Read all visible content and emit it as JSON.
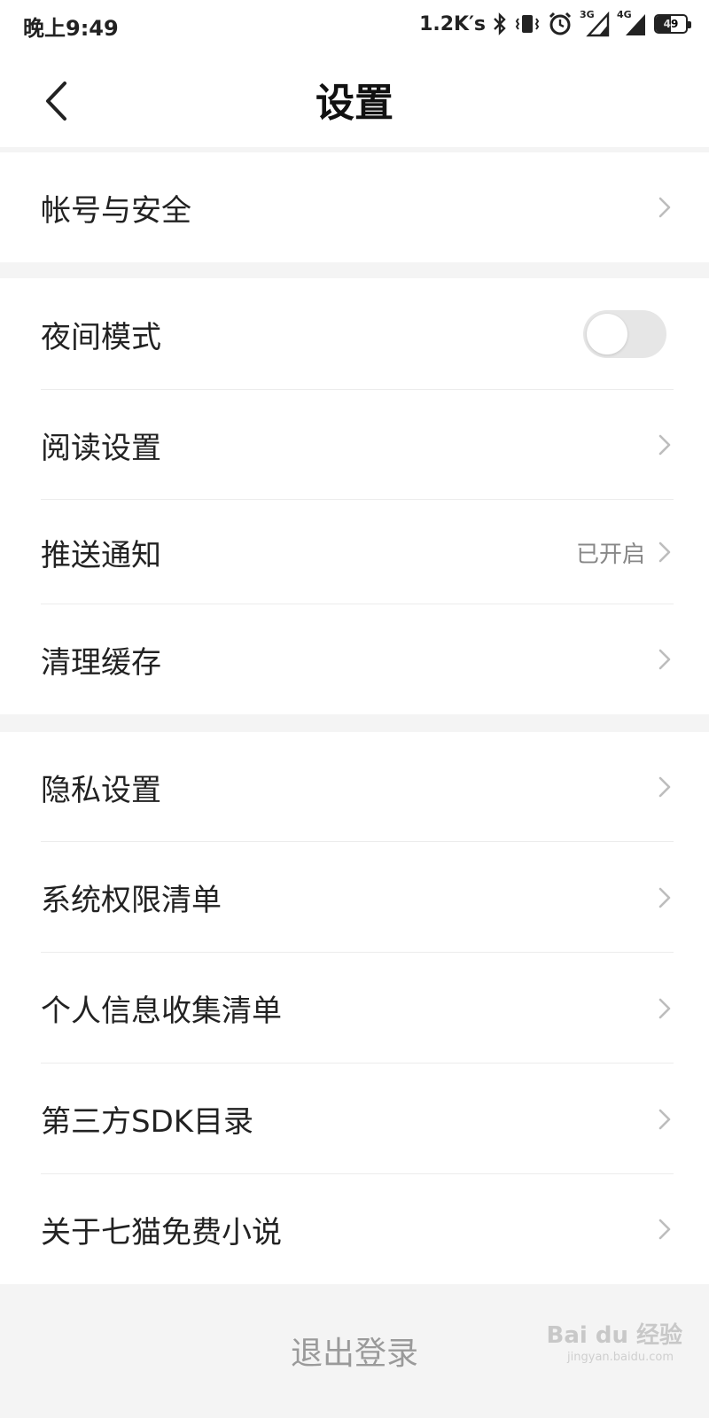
{
  "status_bar": {
    "time": "晚上9:49",
    "net_speed": "1.2K′s",
    "sig1_label": "3G",
    "sig2_label": "4G",
    "battery": "49",
    "battery_level": 0.49
  },
  "nav": {
    "title": "设置"
  },
  "groups": {
    "account": {
      "items": [
        {
          "label": "帐号与安全"
        }
      ]
    },
    "general": {
      "items": [
        {
          "label": "夜间模式",
          "toggle_on": false
        },
        {
          "label": "阅读设置"
        },
        {
          "label": "推送通知",
          "value": "已开启"
        },
        {
          "label": "清理缓存"
        }
      ]
    },
    "about": {
      "items": [
        {
          "label": "隐私设置"
        },
        {
          "label": "系统权限清单"
        },
        {
          "label": "个人信息收集清单"
        },
        {
          "label": "第三方SDK目录"
        },
        {
          "label": "关于七猫免费小说"
        }
      ]
    }
  },
  "logout_label": "退出登录",
  "watermark": {
    "text": "Bai du 经验",
    "sub": "jingyan.baidu.com"
  },
  "colors": {
    "background": "#f4f4f4",
    "card": "#ffffff",
    "text": "#222222",
    "secondary_text": "#888888",
    "toggle_off": "#e6e6e6"
  },
  "icons": {
    "back": "chevron-left-icon",
    "row_arrow": "chevron-right-icon"
  }
}
